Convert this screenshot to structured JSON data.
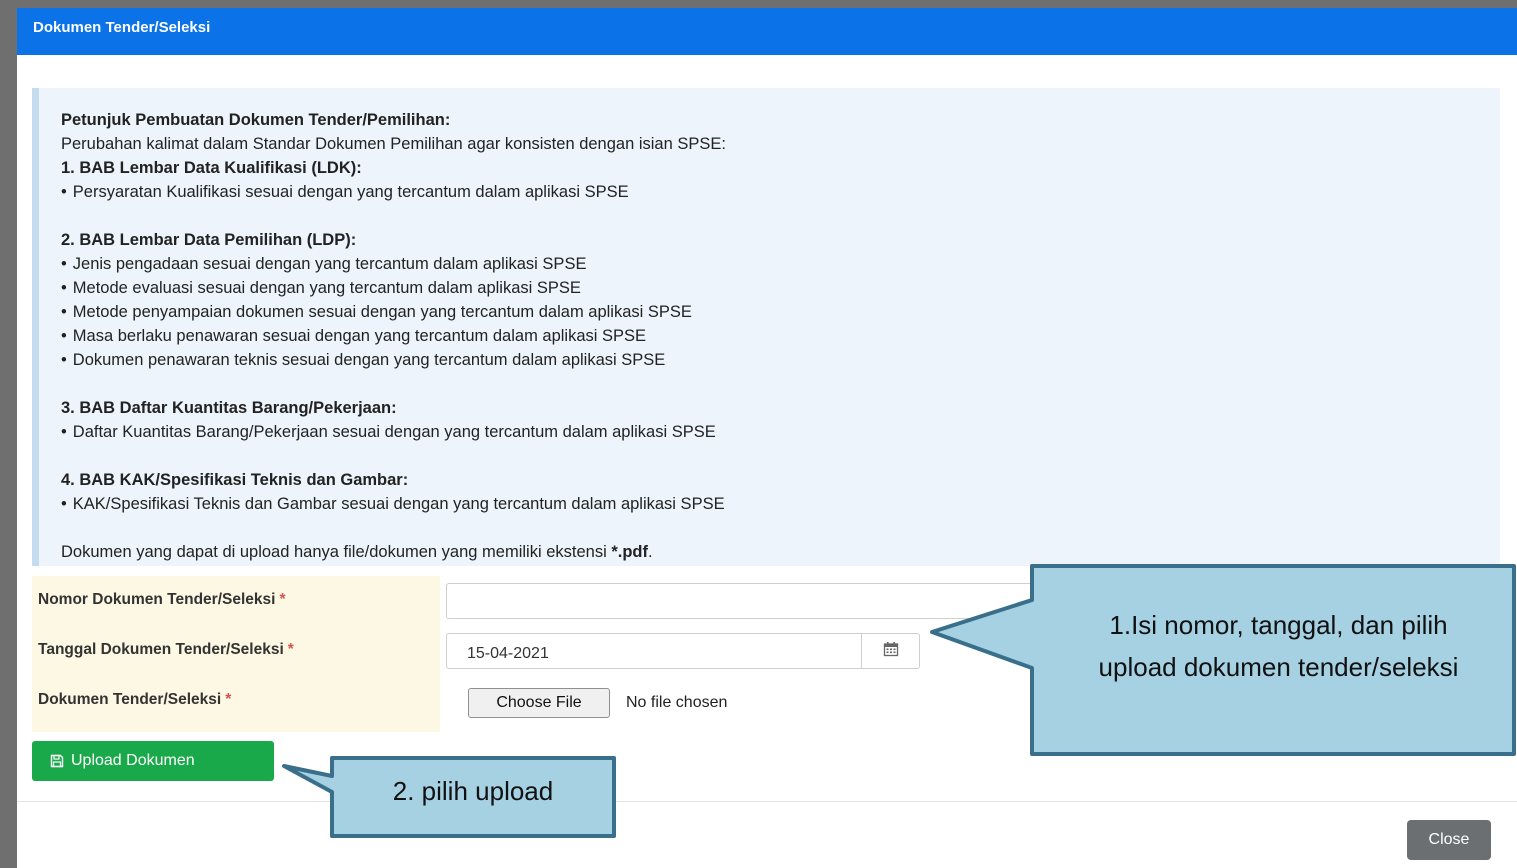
{
  "modal": {
    "title": "Dokumen Tender/Seleksi"
  },
  "instructions": {
    "heading": "Petunjuk Pembuatan Dokumen Tender/Pemilihan:",
    "intro": "Perubahan kalimat dalam Standar Dokumen Pemilihan agar konsisten dengan isian SPSE:",
    "sections": [
      {
        "title": "1. BAB Lembar Data Kualifikasi (LDK):",
        "items": [
          "Persyaratan Kualifikasi sesuai dengan yang tercantum dalam aplikasi SPSE"
        ]
      },
      {
        "title": "2. BAB Lembar Data Pemilihan (LDP):",
        "items": [
          "Jenis pengadaan sesuai dengan yang tercantum dalam aplikasi SPSE",
          "Metode evaluasi sesuai dengan yang tercantum dalam aplikasi SPSE",
          "Metode penyampaian dokumen sesuai dengan yang tercantum dalam aplikasi SPSE",
          "Masa berlaku penawaran sesuai dengan yang tercantum dalam aplikasi SPSE",
          "Dokumen penawaran teknis sesuai dengan yang tercantum dalam aplikasi SPSE"
        ]
      },
      {
        "title": "3. BAB Daftar Kuantitas Barang/Pekerjaan:",
        "items": [
          "Daftar Kuantitas Barang/Pekerjaan sesuai dengan yang tercantum dalam aplikasi SPSE"
        ]
      },
      {
        "title": "4. BAB KAK/Spesifikasi Teknis dan Gambar:",
        "items": [
          "KAK/Spesifikasi Teknis dan Gambar sesuai dengan yang tercantum dalam aplikasi SPSE"
        ]
      }
    ],
    "footer_text": "Dokumen yang dapat di upload hanya file/dokumen yang memiliki ekstensi ",
    "footer_ext": "*.pdf",
    "footer_end": "."
  },
  "form": {
    "nomor_label": "Nomor Dokumen Tender/Seleksi",
    "nomor_value": "",
    "tanggal_label": "Tanggal Dokumen Tender/Seleksi",
    "tanggal_value": "15-04-2021",
    "dokumen_label": "Dokumen Tender/Seleksi",
    "required_mark": "*",
    "choose_file_label": "Choose File",
    "file_status": "No file chosen"
  },
  "buttons": {
    "upload_label": "Upload Dokumen",
    "close_label": "Close"
  },
  "callouts": {
    "first_line1": "1.Isi nomor, tanggal, dan pilih",
    "first_line2": "upload dokumen tender/seleksi",
    "second": "2. pilih upload"
  },
  "colors": {
    "header": "#0b72e7",
    "upload_button": "#1aa94a",
    "callout_fill": "#a5d1e2",
    "callout_border": "#3a6f8b"
  },
  "icons": {
    "calendar": "calendar-icon",
    "upload": "floppy-disk-icon"
  }
}
